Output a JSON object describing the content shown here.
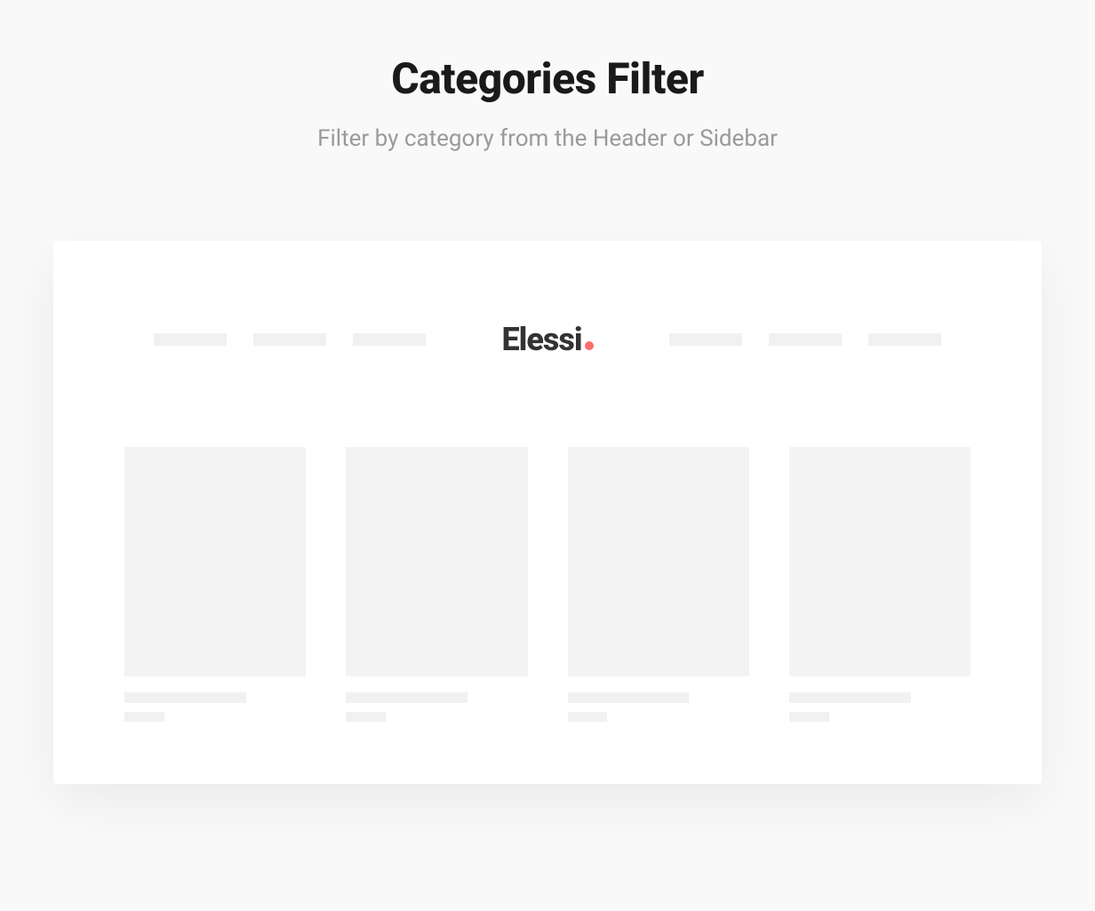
{
  "heading": {
    "title": "Categories Filter",
    "subtitle": "Filter by category from the Header or Sidebar"
  },
  "logo": {
    "text": "Elessi"
  }
}
